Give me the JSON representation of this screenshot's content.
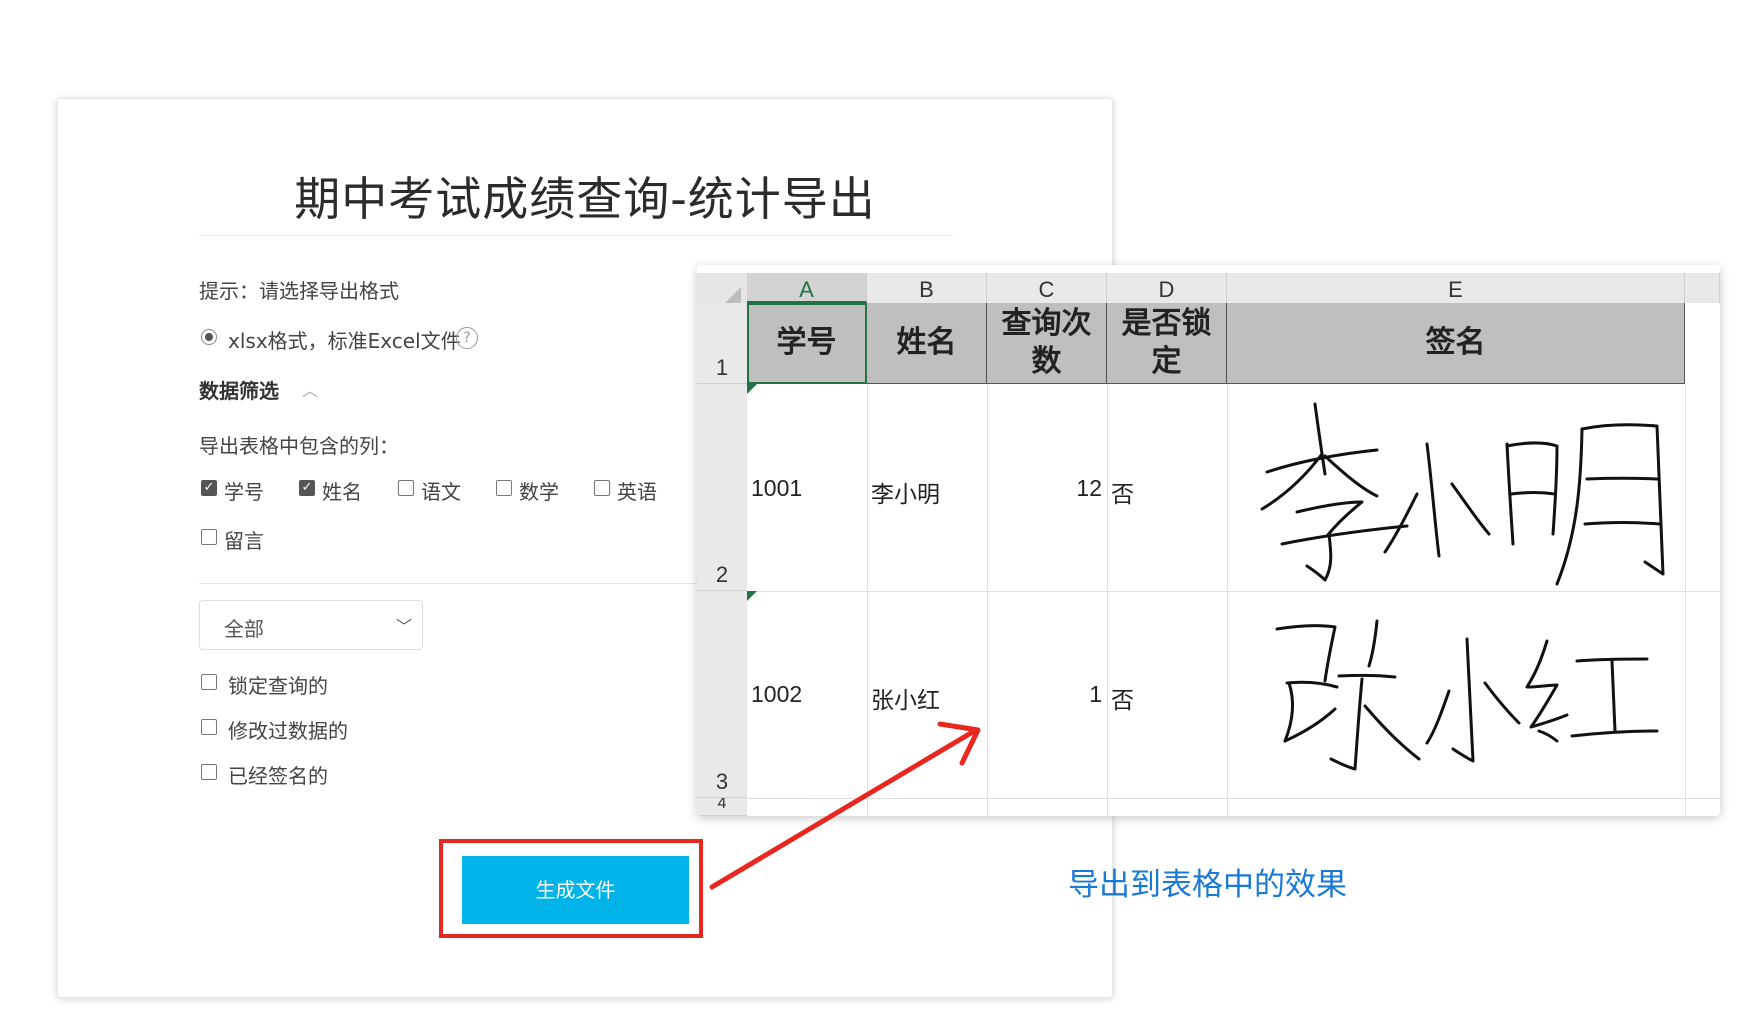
{
  "panel": {
    "title": "期中考试成绩查询-统计导出",
    "hint": "提示：请选择导出格式",
    "format_option": "xlsx格式，标准Excel文件",
    "help_icon": "?",
    "filter_heading": "数据筛选",
    "columns_label": "导出表格中包含的列：",
    "columns": [
      {
        "label": "学号",
        "checked": true
      },
      {
        "label": "姓名",
        "checked": true
      },
      {
        "label": "语文",
        "checked": false
      },
      {
        "label": "数学",
        "checked": false
      },
      {
        "label": "英语",
        "checked": false
      },
      {
        "label": "留言",
        "checked": false
      }
    ],
    "scope_select": "全部",
    "filters": [
      {
        "label": "锁定查询的",
        "checked": false
      },
      {
        "label": "修改过数据的",
        "checked": false
      },
      {
        "label": "已经签名的",
        "checked": false
      }
    ],
    "generate_button": "生成文件"
  },
  "sheet": {
    "column_letters": [
      "A",
      "B",
      "C",
      "D",
      "E"
    ],
    "row_numbers": [
      "1",
      "2",
      "3",
      "4"
    ],
    "headers": [
      "学号",
      "姓名",
      "查询次数",
      "是否锁定",
      "签名"
    ],
    "rows": [
      {
        "id": "1001",
        "name": "李小明",
        "count": "12",
        "locked": "否",
        "signature": "李小明"
      },
      {
        "id": "1002",
        "name": "张小红",
        "count": "1",
        "locked": "否",
        "signature": "张小红"
      }
    ]
  },
  "caption": "导出到表格中的效果",
  "colors": {
    "button": "#00b4ea",
    "highlight_frame": "#e8271f",
    "caption": "#1a7ad8",
    "excel_green": "#217346",
    "header_fill": "#bfbfbf"
  }
}
